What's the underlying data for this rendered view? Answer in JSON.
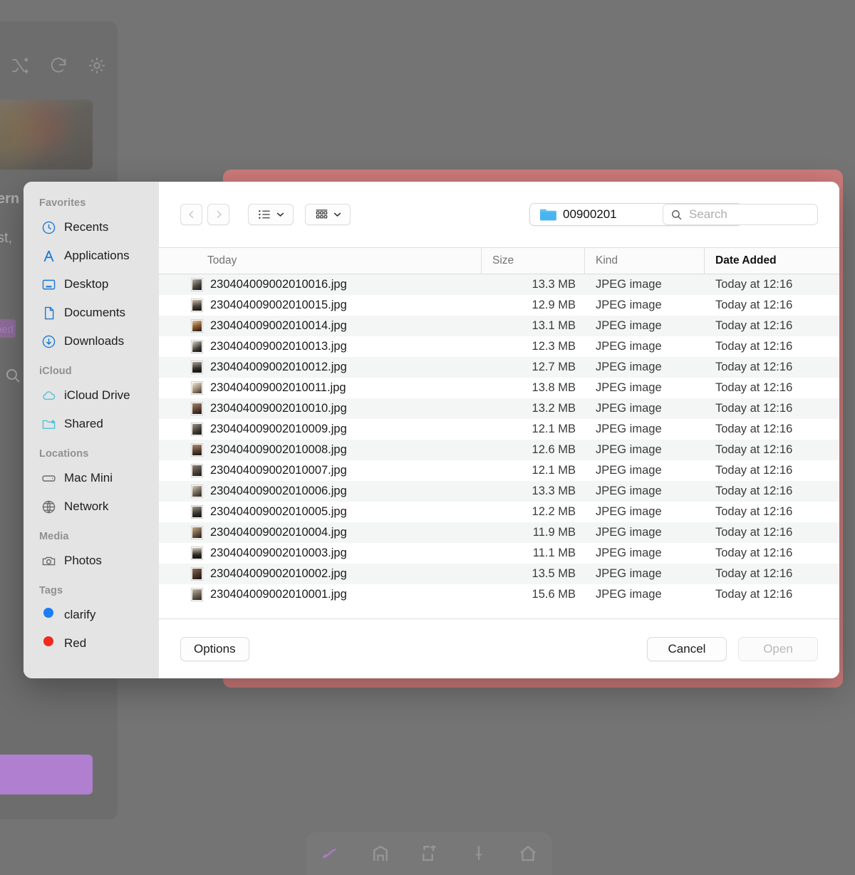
{
  "background": {
    "icons": [
      "shuffle-icon",
      "reload-icon",
      "gear-icon"
    ],
    "text_fragment_1": "ern",
    "text_fragment_2": "st,",
    "chip_text": "bed",
    "dock_icons": [
      "path-tool-icon",
      "building-icon",
      "export-icon",
      "pin-icon",
      "home-icon"
    ]
  },
  "sidebar": {
    "sections": [
      {
        "title": "Favorites",
        "items": [
          {
            "label": "Recents",
            "icon": "clock-icon",
            "tint": "blue"
          },
          {
            "label": "Applications",
            "icon": "applications-icon",
            "tint": "blue"
          },
          {
            "label": "Desktop",
            "icon": "desktop-icon",
            "tint": "blue"
          },
          {
            "label": "Documents",
            "icon": "document-icon",
            "tint": "blue"
          },
          {
            "label": "Downloads",
            "icon": "download-icon",
            "tint": "blue"
          }
        ]
      },
      {
        "title": "iCloud",
        "items": [
          {
            "label": "iCloud Drive",
            "icon": "cloud-icon",
            "tint": "cyan"
          },
          {
            "label": "Shared",
            "icon": "shared-folder-icon",
            "tint": "cyan"
          }
        ]
      },
      {
        "title": "Locations",
        "items": [
          {
            "label": "Mac Mini",
            "icon": "mac-mini-icon",
            "tint": "grey"
          },
          {
            "label": "Network",
            "icon": "globe-icon",
            "tint": "grey"
          }
        ]
      },
      {
        "title": "Media",
        "items": [
          {
            "label": "Photos",
            "icon": "camera-icon",
            "tint": "grey"
          }
        ]
      },
      {
        "title": "Tags",
        "items": [
          {
            "label": "clarify",
            "icon": "tag-dot-icon",
            "color": "#1d7df5"
          },
          {
            "label": "Red",
            "icon": "tag-dot-icon",
            "color": "#f02a20"
          }
        ]
      }
    ]
  },
  "toolbar": {
    "back_icon": "chevron-left-icon",
    "forward_icon": "chevron-right-icon",
    "view_menu_icon": "list-view-icon",
    "group_menu_icon": "group-by-icon",
    "chevron_icon": "chevron-down-icon",
    "path": "00900201",
    "folder_icon": "folder-icon",
    "stepper_icon": "stepper-updown-icon",
    "search_placeholder": "Search",
    "search_value": "",
    "search_icon": "search-icon"
  },
  "columns": {
    "name": "Today",
    "size": "Size",
    "kind": "Kind",
    "date": "Date Added",
    "sorted_by": "Date Added"
  },
  "files": [
    {
      "name": "230404009002010016.jpg",
      "size": "13.3 MB",
      "kind": "JPEG image",
      "date": "Today at 12:16"
    },
    {
      "name": "230404009002010015.jpg",
      "size": "12.9 MB",
      "kind": "JPEG image",
      "date": "Today at 12:16"
    },
    {
      "name": "230404009002010014.jpg",
      "size": "13.1 MB",
      "kind": "JPEG image",
      "date": "Today at 12:16"
    },
    {
      "name": "230404009002010013.jpg",
      "size": "12.3 MB",
      "kind": "JPEG image",
      "date": "Today at 12:16"
    },
    {
      "name": "230404009002010012.jpg",
      "size": "12.7 MB",
      "kind": "JPEG image",
      "date": "Today at 12:16"
    },
    {
      "name": "230404009002010011.jpg",
      "size": "13.8 MB",
      "kind": "JPEG image",
      "date": "Today at 12:16"
    },
    {
      "name": "230404009002010010.jpg",
      "size": "13.2 MB",
      "kind": "JPEG image",
      "date": "Today at 12:16"
    },
    {
      "name": "230404009002010009.jpg",
      "size": "12.1 MB",
      "kind": "JPEG image",
      "date": "Today at 12:16"
    },
    {
      "name": "230404009002010008.jpg",
      "size": "12.6 MB",
      "kind": "JPEG image",
      "date": "Today at 12:16"
    },
    {
      "name": "230404009002010007.jpg",
      "size": "12.1 MB",
      "kind": "JPEG image",
      "date": "Today at 12:16"
    },
    {
      "name": "230404009002010006.jpg",
      "size": "13.3 MB",
      "kind": "JPEG image",
      "date": "Today at 12:16"
    },
    {
      "name": "230404009002010005.jpg",
      "size": "12.2 MB",
      "kind": "JPEG image",
      "date": "Today at 12:16"
    },
    {
      "name": "230404009002010004.jpg",
      "size": "11.9 MB",
      "kind": "JPEG image",
      "date": "Today at 12:16"
    },
    {
      "name": "230404009002010003.jpg",
      "size": "11.1 MB",
      "kind": "JPEG image",
      "date": "Today at 12:16"
    },
    {
      "name": "230404009002010002.jpg",
      "size": "13.5 MB",
      "kind": "JPEG image",
      "date": "Today at 12:16"
    },
    {
      "name": "230404009002010001.jpg",
      "size": "15.6 MB",
      "kind": "JPEG image",
      "date": "Today at 12:16"
    }
  ],
  "footer": {
    "options_label": "Options",
    "cancel_label": "Cancel",
    "open_label": "Open",
    "open_disabled": true
  },
  "colors": {
    "host_window_border": "#cd7b7b",
    "accent_blue": "#1d84f5",
    "sidebar_bg": "#e4e4e4",
    "row_alt": "#f4f5f5",
    "desktop_bg": "#747474",
    "purple_block": "#b07fd0"
  }
}
